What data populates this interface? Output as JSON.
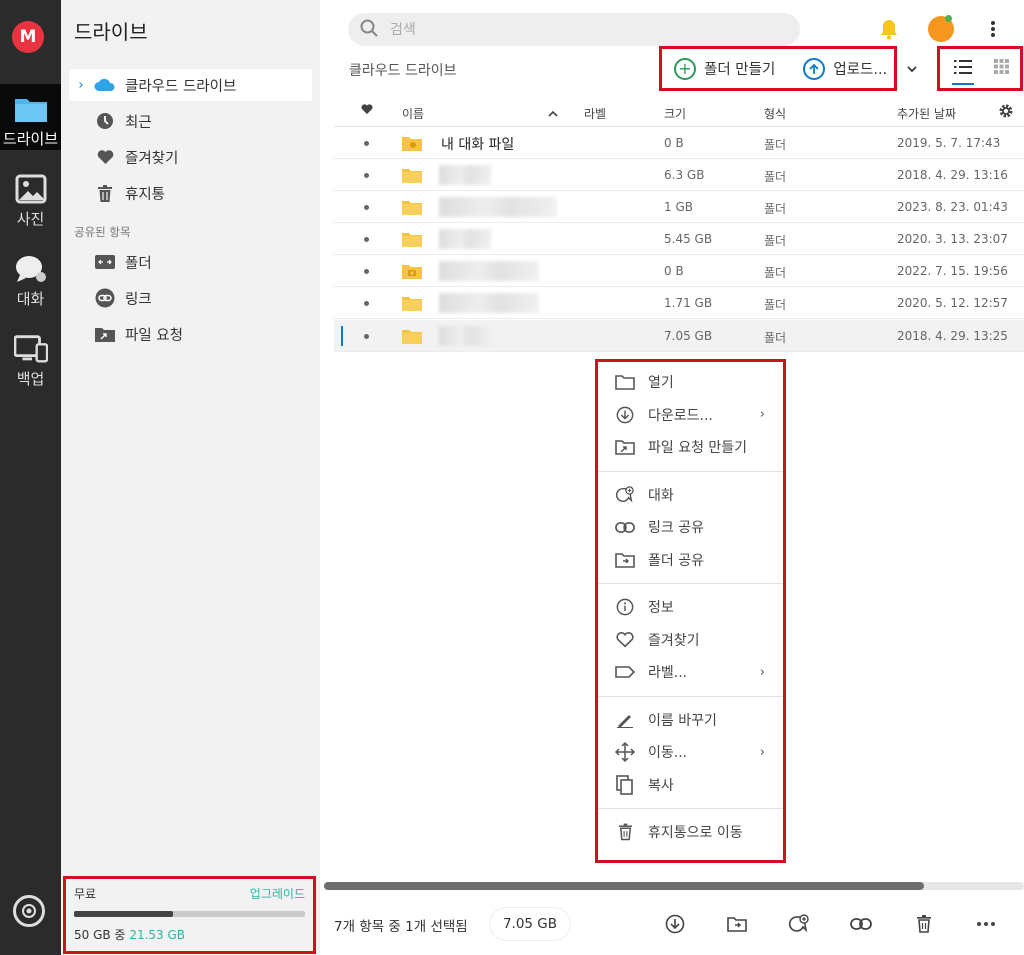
{
  "app": {
    "logo_letter": "M",
    "accent": "#0a7aca",
    "brand": "#e8343f",
    "highlight": "#d0101e"
  },
  "rail": {
    "items": [
      {
        "label": "드라이브",
        "icon": "folder-icon",
        "active": true
      },
      {
        "label": "사진",
        "icon": "photo-icon"
      },
      {
        "label": "대화",
        "icon": "chat-icon"
      },
      {
        "label": "백업",
        "icon": "devices-icon"
      }
    ],
    "bottom_icon": "sync-status-icon"
  },
  "sidebar": {
    "title": "드라이브",
    "items": [
      {
        "label": "클라우드 드라이브",
        "icon": "cloud-icon",
        "active": true
      },
      {
        "label": "최근",
        "icon": "clock-icon"
      },
      {
        "label": "즐겨찾기",
        "icon": "heart-icon"
      },
      {
        "label": "휴지통",
        "icon": "trash-icon"
      }
    ],
    "shared_section": "공유된 항목",
    "shared_items": [
      {
        "label": "폴더",
        "icon": "shared-folder-icon"
      },
      {
        "label": "링크",
        "icon": "link-icon"
      },
      {
        "label": "파일 요청",
        "icon": "file-request-icon"
      }
    ],
    "storage": {
      "plan": "무료",
      "upgrade": "업그레이드",
      "total": "50 GB 중",
      "used": "21.53 GB",
      "used_fraction": 0.43
    }
  },
  "header": {
    "search_placeholder": "검색",
    "breadcrumb": "클라우드 드라이브",
    "new_folder": "폴더 만들기",
    "upload": "업로드..."
  },
  "table": {
    "columns": [
      "이름",
      "라벨",
      "크기",
      "형식",
      "추가된 날짜"
    ],
    "rows": [
      {
        "name": "내 대화 파일",
        "size": "0 B",
        "type": "폴더",
        "date": "2019. 5. 7. 17:43"
      },
      {
        "name": "",
        "size": "6.3 GB",
        "type": "폴더",
        "date": "2018. 4. 29. 13:16"
      },
      {
        "name": "",
        "size": "1 GB",
        "type": "폴더",
        "date": "2023. 8. 23. 01:43"
      },
      {
        "name": "",
        "size": "5.45 GB",
        "type": "폴더",
        "date": "2020. 3. 13. 23:07"
      },
      {
        "name": "",
        "size": "0 B",
        "type": "폴더",
        "date": "2022. 7. 15. 19:56"
      },
      {
        "name": "",
        "size": "1.71 GB",
        "type": "폴더",
        "date": "2020. 5. 12. 12:57"
      },
      {
        "name": "",
        "size": "7.05 GB",
        "type": "폴더",
        "date": "2018. 4. 29. 13:25"
      }
    ]
  },
  "context_menu": {
    "open": "열기",
    "download": "다운로드...",
    "file_request": "파일 요청 만들기",
    "chat": "대화",
    "share_link": "링크 공유",
    "share_folder": "폴더 공유",
    "info": "정보",
    "favourite": "즐겨찾기",
    "label": "라벨...",
    "rename": "이름 바꾸기",
    "move": "이동...",
    "copy": "복사",
    "trash": "휴지통으로 이동"
  },
  "footer": {
    "status": "7개 항목 중 1개 선택됨",
    "size": "7.05 GB"
  }
}
